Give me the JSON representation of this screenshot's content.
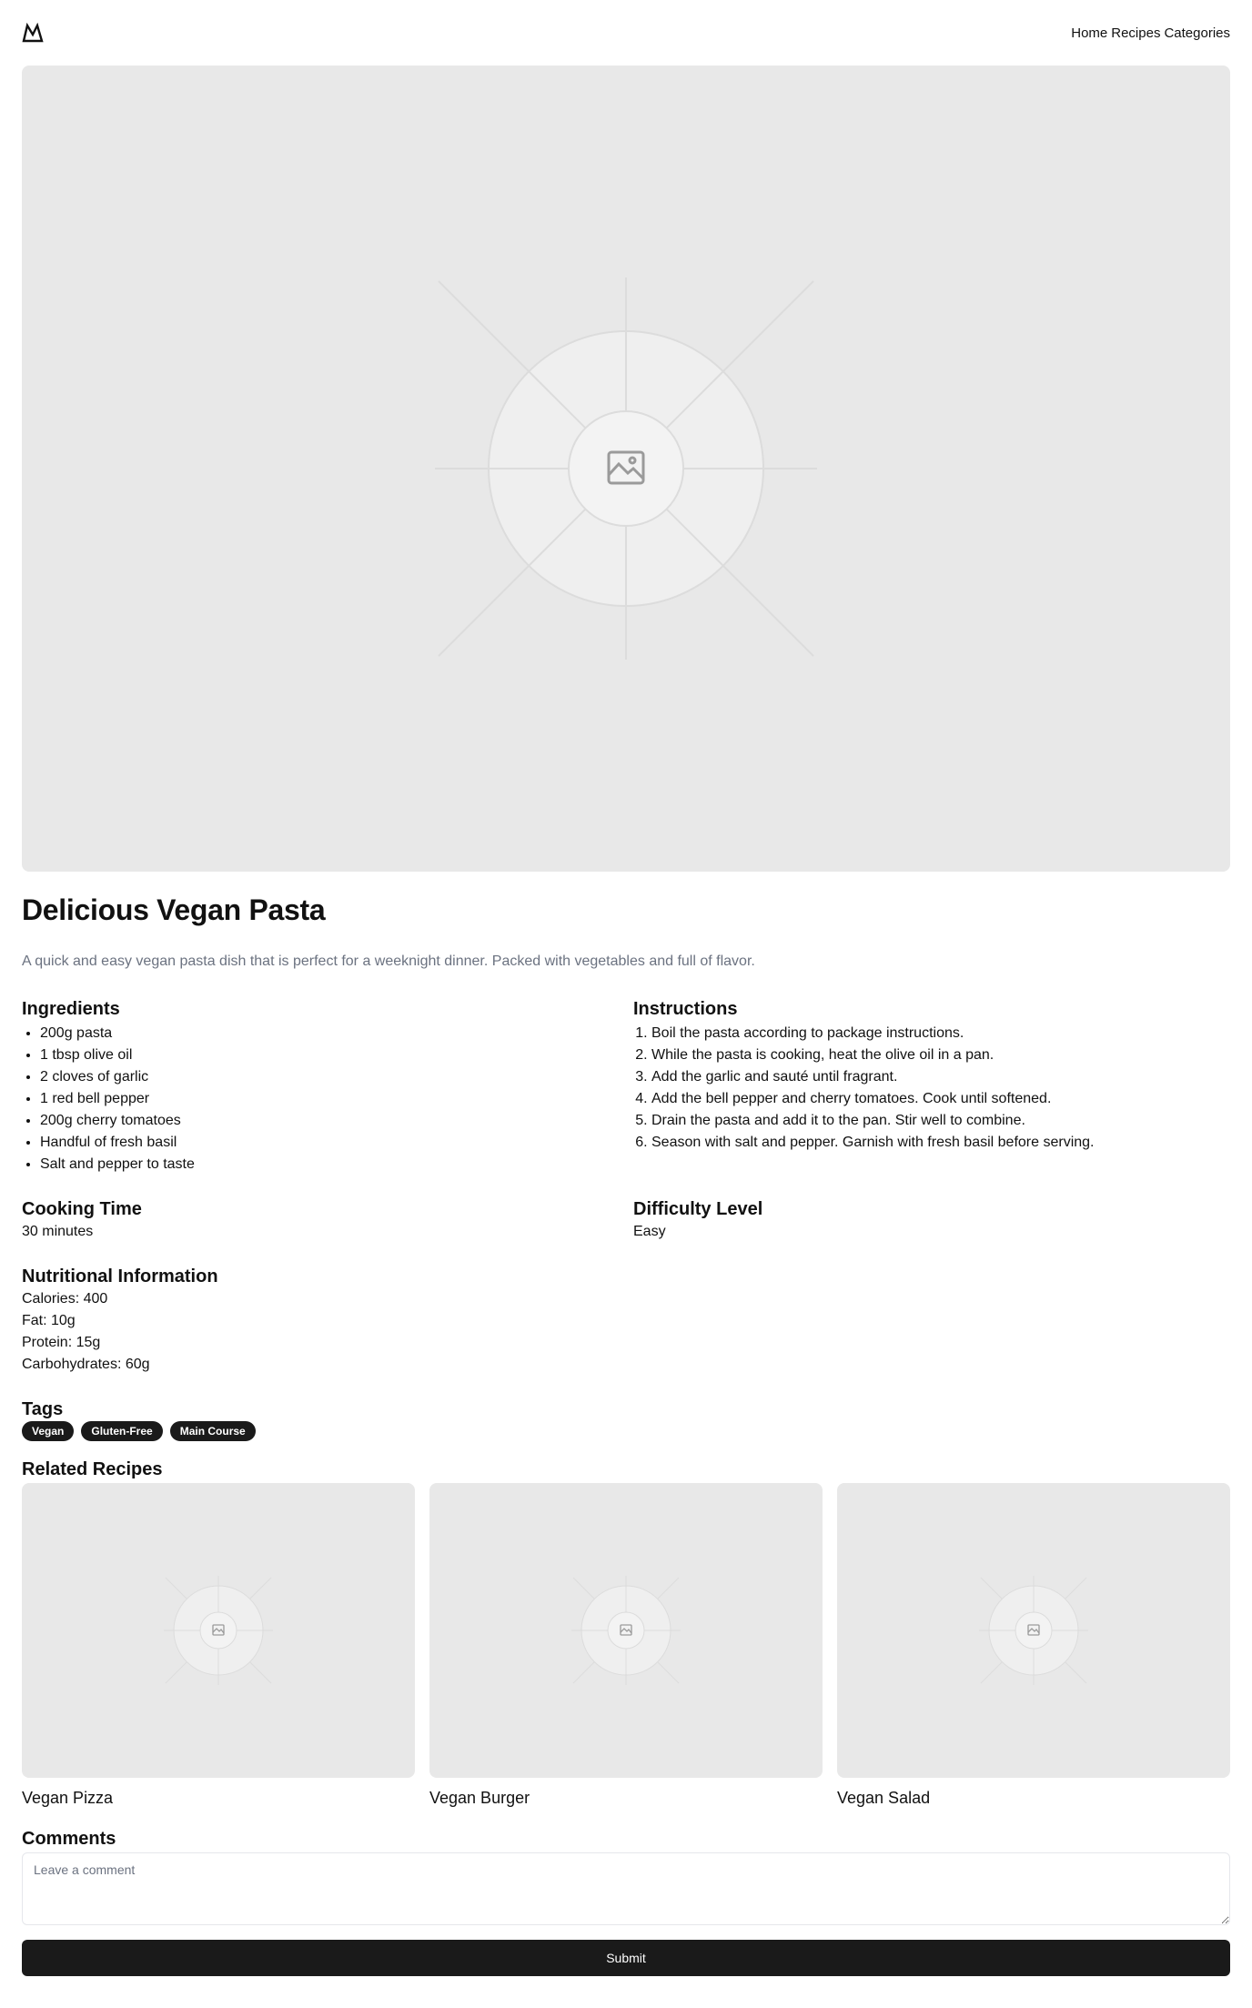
{
  "header": {
    "logo_icon": "mountain-logo-icon",
    "nav": [
      "Home",
      "Recipes",
      "Categories"
    ]
  },
  "hero": {
    "image_icon": "image-placeholder-icon"
  },
  "recipe": {
    "title": "Delicious Vegan Pasta",
    "description": "A quick and easy vegan pasta dish that is perfect for a weeknight dinner. Packed with vegetables and full of flavor."
  },
  "ingredients": {
    "heading": "Ingredients",
    "items": [
      "200g pasta",
      "1 tbsp olive oil",
      "2 cloves of garlic",
      "1 red bell pepper",
      "200g cherry tomatoes",
      "Handful of fresh basil",
      "Salt and pepper to taste"
    ]
  },
  "instructions": {
    "heading": "Instructions",
    "items": [
      "Boil the pasta according to package instructions.",
      "While the pasta is cooking, heat the olive oil in a pan.",
      "Add the garlic and sauté until fragrant.",
      "Add the bell pepper and cherry tomatoes. Cook until softened.",
      "Drain the pasta and add it to the pan. Stir well to combine.",
      "Season with salt and pepper. Garnish with fresh basil before serving."
    ]
  },
  "cooking_time": {
    "heading": "Cooking Time",
    "value": "30 minutes"
  },
  "difficulty": {
    "heading": "Difficulty Level",
    "value": "Easy"
  },
  "nutrition": {
    "heading": "Nutritional Information",
    "items": [
      "Calories: 400",
      "Fat: 10g",
      "Protein: 15g",
      "Carbohydrates: 60g"
    ]
  },
  "tags": {
    "heading": "Tags",
    "items": [
      "Vegan",
      "Gluten-Free",
      "Main Course"
    ]
  },
  "related": {
    "heading": "Related Recipes",
    "items": [
      "Vegan Pizza",
      "Vegan Burger",
      "Vegan Salad"
    ]
  },
  "comments": {
    "heading": "Comments",
    "placeholder": "Leave a comment",
    "submit_label": "Submit"
  },
  "colors": {
    "placeholder_bg": "#e8e8e8",
    "button_bg": "#1a1a1a",
    "muted_text": "#6b7280"
  }
}
